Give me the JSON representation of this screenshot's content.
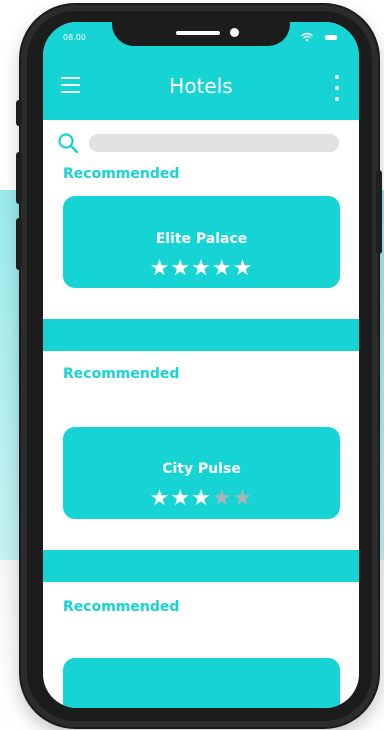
{
  "status_bar": {
    "time": "08.00"
  },
  "app_bar": {
    "title": "Hotels"
  },
  "search": {
    "value": ""
  },
  "sections": [
    {
      "label": "Recommended",
      "hotel": {
        "name": "Elite Palace",
        "rating": 5,
        "max_rating": 5
      }
    },
    {
      "label": "Recommended",
      "hotel": {
        "name": "City Pulse",
        "rating": 3,
        "max_rating": 5
      }
    },
    {
      "label": "Recommended",
      "hotel": {
        "name": "",
        "rating": 0,
        "max_rating": 0
      }
    }
  ],
  "colors": {
    "accent": "#17d4d4",
    "star_filled": "#ffffff",
    "star_empty": "#a7b6b7",
    "search_bg": "#e1e1e1"
  },
  "icons": [
    "menu-icon",
    "kebab-menu-icon",
    "search-icon",
    "wifi-icon",
    "battery-icon"
  ]
}
